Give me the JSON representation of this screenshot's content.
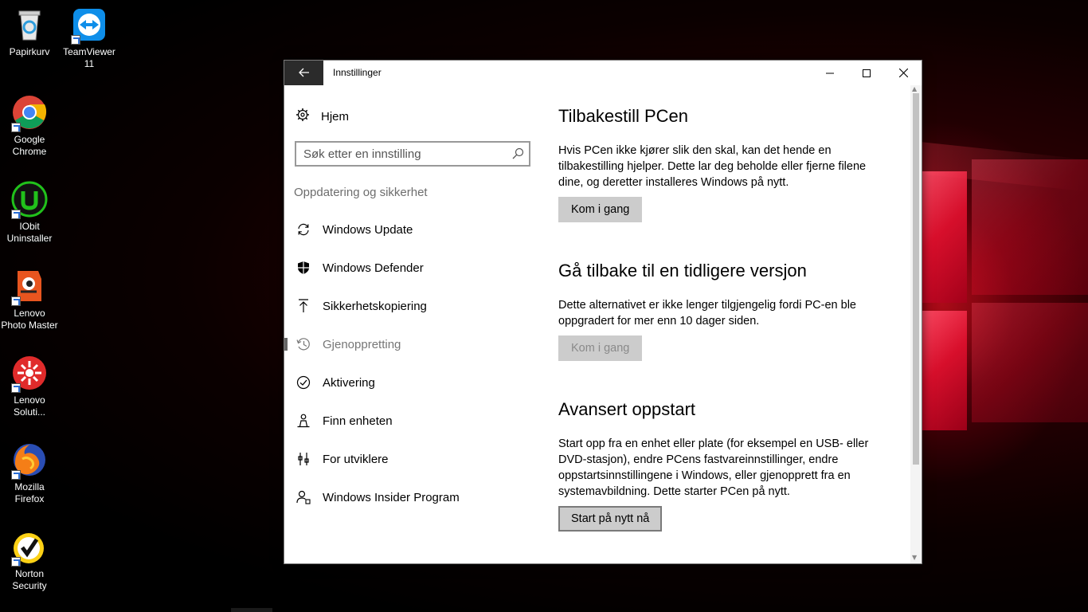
{
  "desktop": {
    "icons": [
      {
        "label": "Papirkurv",
        "icon": "recycle-bin-icon"
      },
      {
        "label": "TeamViewer 11",
        "icon": "teamviewer-icon"
      },
      {
        "label": "Google Chrome",
        "icon": "chrome-icon"
      },
      {
        "label": "IObit Uninstaller",
        "icon": "iobit-uninstaller-icon"
      },
      {
        "label": "Lenovo Photo Master",
        "icon": "lenovo-photo-master-icon"
      },
      {
        "label": "Lenovo Soluti...",
        "icon": "lenovo-solutions-icon"
      },
      {
        "label": "Mozilla Firefox",
        "icon": "firefox-icon"
      },
      {
        "label": "Norton Security",
        "icon": "norton-icon"
      }
    ]
  },
  "window": {
    "title": "Innstillinger",
    "back_icon": "back-arrow-icon",
    "controls": {
      "minimize": "minimize-icon",
      "maximize": "maximize-icon",
      "close": "close-icon"
    }
  },
  "nav": {
    "home_label": "Hjem",
    "search_placeholder": "Søk etter en innstilling",
    "section_label": "Oppdatering og sikkerhet",
    "items": [
      {
        "label": "Windows Update",
        "icon": "sync-icon",
        "selected": false
      },
      {
        "label": "Windows Defender",
        "icon": "shield-icon",
        "selected": false
      },
      {
        "label": "Sikkerhetskopiering",
        "icon": "backup-arrow-icon",
        "selected": false
      },
      {
        "label": "Gjenoppretting",
        "icon": "history-icon",
        "selected": true
      },
      {
        "label": "Aktivering",
        "icon": "check-circle-icon",
        "selected": false
      },
      {
        "label": "Finn enheten",
        "icon": "person-locate-icon",
        "selected": false
      },
      {
        "label": "For utviklere",
        "icon": "developer-tools-icon",
        "selected": false
      },
      {
        "label": "Windows Insider Program",
        "icon": "insider-icon",
        "selected": false
      }
    ]
  },
  "content": {
    "reset": {
      "heading": "Tilbakestill PCen",
      "text": "Hvis PCen ikke kjører slik den skal, kan det hende en tilbakestilling hjelper. Dette lar deg beholde eller fjerne filene dine, og deretter installeres Windows på nytt.",
      "button": "Kom i gang"
    },
    "rollback": {
      "heading": "Gå tilbake til en tidligere versjon",
      "text": "Dette alternativet er ikke lenger tilgjengelig fordi PC-en ble oppgradert for mer enn 10 dager siden.",
      "button": "Kom i gang"
    },
    "advanced": {
      "heading": "Avansert oppstart",
      "text": "Start opp fra en enhet eller plate (for eksempel en USB- eller DVD-stasjon), endre PCens fastvareinnstillinger, endre oppstartsinnstillingene i Windows, eller gjenopprett fra en systemavbildning. Dette starter PCen på nytt.",
      "button": "Start på nytt nå"
    }
  }
}
